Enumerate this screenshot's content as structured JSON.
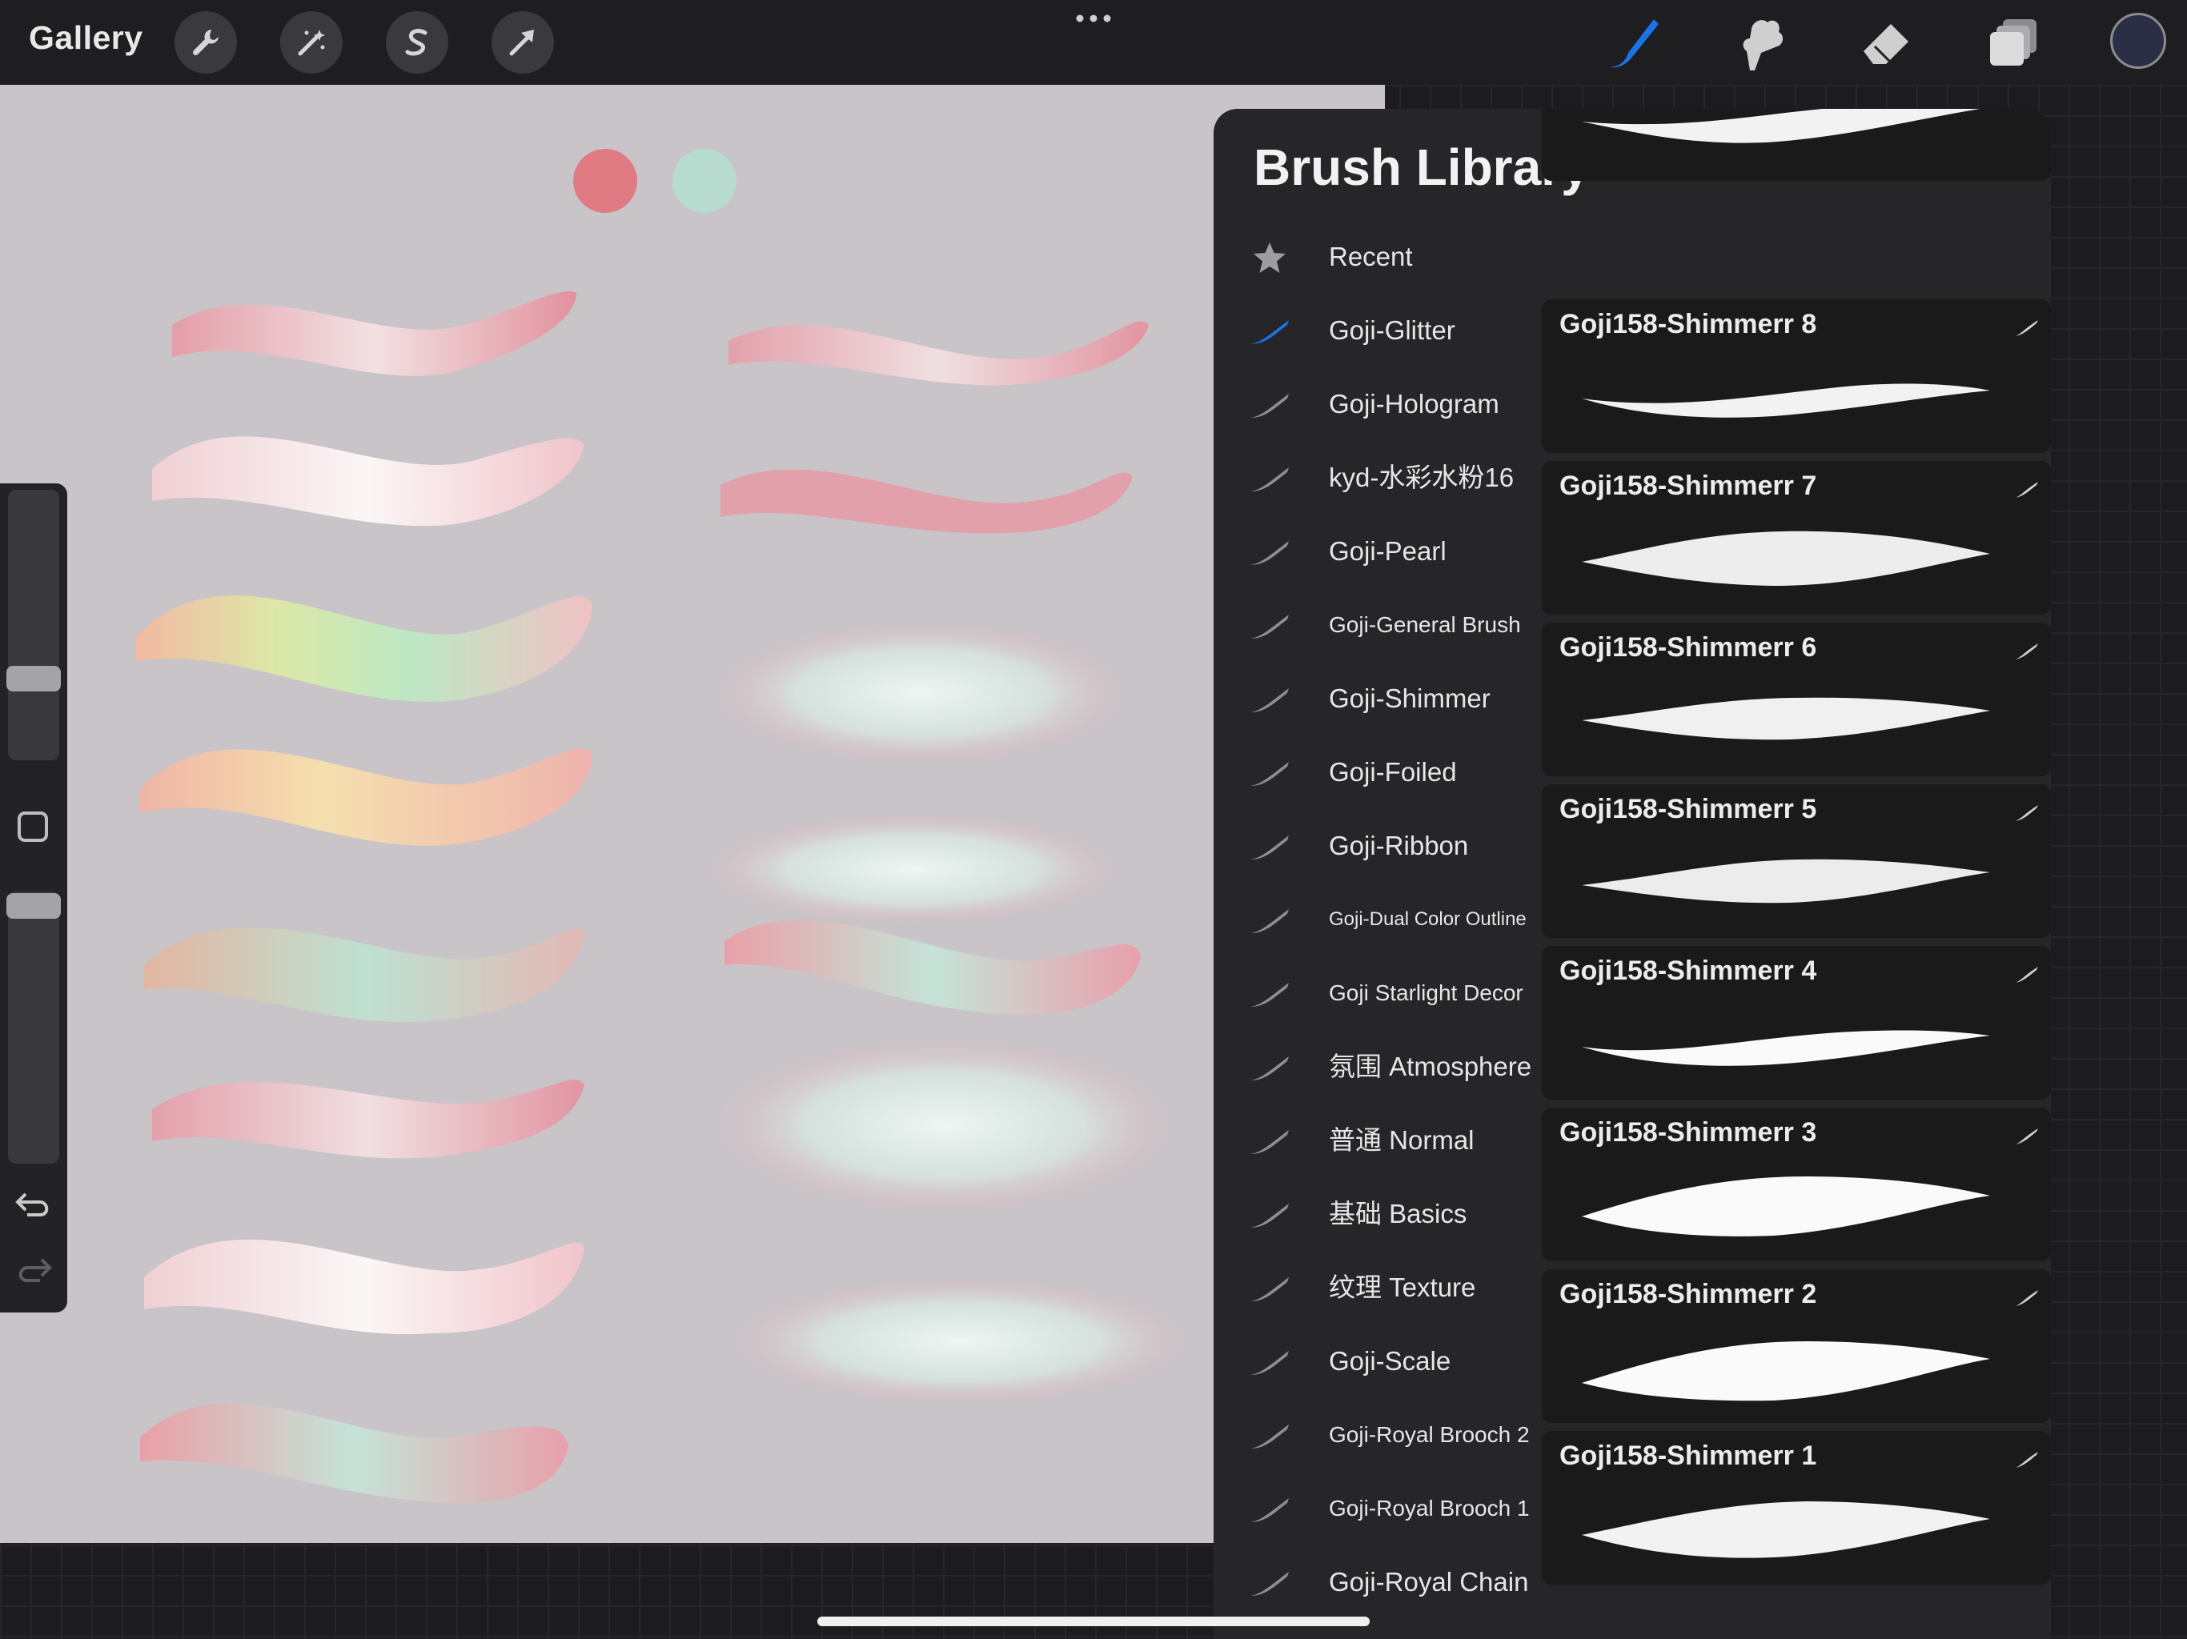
{
  "toolbar": {
    "gallery_label": "Gallery",
    "left_tools": [
      "wrench-icon",
      "magic-wand-icon",
      "selection-s-icon",
      "transform-arrow-icon"
    ],
    "right_tools": [
      "brush-icon",
      "smudge-icon",
      "eraser-icon",
      "layers-icon"
    ],
    "active_tool": "brush-icon",
    "accent_color": "#1a73e8",
    "color_well": "#2b2f45"
  },
  "canvas": {
    "swatches": [
      "#e07b83",
      "#b7dccf"
    ]
  },
  "brush_library": {
    "title": "Brush Library",
    "sets": [
      {
        "label": "Recent",
        "icon": "star-icon"
      },
      {
        "label": "Goji-Glitter",
        "icon": "brush-stroke-icon",
        "selected": true
      },
      {
        "label": "Goji-Hologram",
        "icon": "brush-stroke-icon"
      },
      {
        "label": "kyd-水彩水粉16",
        "icon": "brush-stroke-icon"
      },
      {
        "label": "Goji-Pearl",
        "icon": "brush-stroke-icon"
      },
      {
        "label": "Goji-General Brush",
        "icon": "brush-stroke-icon",
        "size": "small"
      },
      {
        "label": "Goji-Shimmer",
        "icon": "brush-stroke-icon"
      },
      {
        "label": "Goji-Foiled",
        "icon": "brush-stroke-icon"
      },
      {
        "label": "Goji-Ribbon",
        "icon": "brush-stroke-icon"
      },
      {
        "label": "Goji-Dual Color Outline",
        "icon": "brush-stroke-icon",
        "size": "xsmall"
      },
      {
        "label": "Goji Starlight Decor",
        "icon": "brush-stroke-icon",
        "size": "small"
      },
      {
        "label": "氛围 Atmosphere",
        "icon": "brush-stroke-icon"
      },
      {
        "label": "普通 Normal",
        "icon": "brush-stroke-icon"
      },
      {
        "label": "基础 Basics",
        "icon": "brush-stroke-icon"
      },
      {
        "label": "纹理 Texture",
        "icon": "brush-stroke-icon"
      },
      {
        "label": "Goji-Scale",
        "icon": "brush-stroke-icon"
      },
      {
        "label": "Goji-Royal Brooch 2",
        "icon": "brush-stroke-icon",
        "size": "small"
      },
      {
        "label": "Goji-Royal Brooch 1",
        "icon": "brush-stroke-icon",
        "size": "small"
      },
      {
        "label": "Goji-Royal Chain",
        "icon": "brush-stroke-icon"
      }
    ],
    "brushes": [
      {
        "name": "Goji158-Shimmerr 8"
      },
      {
        "name": "Goji158-Shimmerr 7"
      },
      {
        "name": "Goji158-Shimmerr 6"
      },
      {
        "name": "Goji158-Shimmerr 5"
      },
      {
        "name": "Goji158-Shimmerr 4"
      },
      {
        "name": "Goji158-Shimmerr 3"
      },
      {
        "name": "Goji158-Shimmerr 2"
      },
      {
        "name": "Goji158-Shimmerr 1"
      }
    ]
  }
}
